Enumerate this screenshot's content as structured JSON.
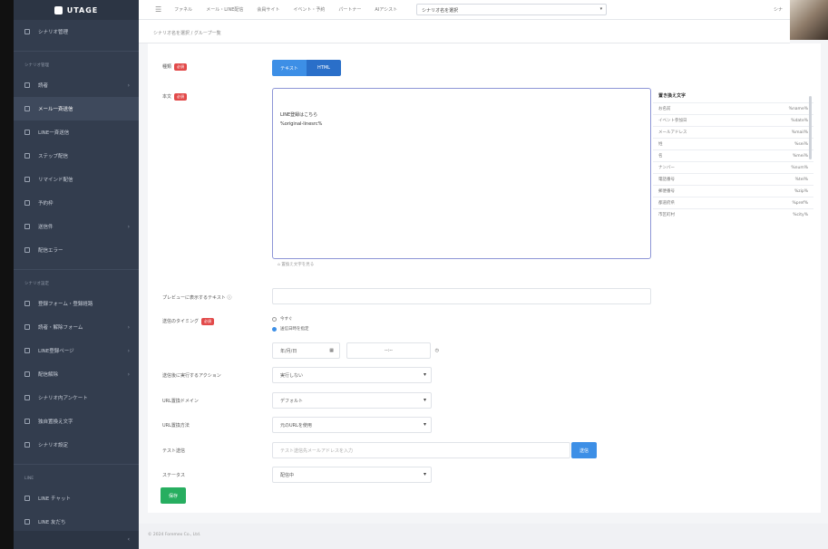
{
  "app": {
    "logo": "UTAGE"
  },
  "sidebar": {
    "top_item": "シナリオ管理",
    "section1": "シナリオ管理",
    "items1": [
      {
        "label": "読者",
        "arrow": "›"
      },
      {
        "label": "メール一斉送信",
        "arrow": ""
      },
      {
        "label": "LINE一斉送信",
        "arrow": ""
      },
      {
        "label": "ステップ配信",
        "arrow": ""
      },
      {
        "label": "リマインド配信",
        "arrow": ""
      },
      {
        "label": "予約枠",
        "arrow": ""
      },
      {
        "label": "送信件",
        "arrow": "›"
      },
      {
        "label": "配信エラー",
        "arrow": ""
      }
    ],
    "section2": "シナリオ設定",
    "items2": [
      {
        "label": "登録フォーム・登録経路",
        "arrow": ""
      },
      {
        "label": "読者・解除フォーム",
        "arrow": "›"
      },
      {
        "label": "LINE登録ページ",
        "arrow": "›"
      },
      {
        "label": "配信解除",
        "arrow": "›"
      },
      {
        "label": "シナリオ内アンケート",
        "arrow": ""
      },
      {
        "label": "独自置換え文字",
        "arrow": ""
      },
      {
        "label": "シナリオ設定",
        "arrow": ""
      }
    ],
    "section3": "LINE",
    "items3": [
      {
        "label": "LINE チャット",
        "arrow": ""
      },
      {
        "label": "LINE 友だち",
        "arrow": ""
      }
    ],
    "collapse": "‹"
  },
  "topbar": {
    "menu_icon": "☰",
    "nav": [
      "ファネル",
      "メール・LINE配信",
      "会員サイト",
      "イベント・予約",
      "パートナー",
      "AIアシスト"
    ],
    "selector": "シナリオ名を選択",
    "user": "シナ"
  },
  "breadcrumb": "シナリオ名を選択 / グループ一覧",
  "form": {
    "type_label": "種類",
    "required": "必須",
    "type_options": [
      "テキスト",
      "HTML"
    ],
    "body_label": "本文",
    "body_lines": [
      "LINE登録はこちら",
      "%original-linesrc%"
    ],
    "body_hint": "⌂ 置換え文字を見る",
    "tags_header": "置き換え文字",
    "tags": [
      {
        "name": "お名前",
        "code": "%name%"
      },
      {
        "name": "イベント参加日",
        "code": "%date%"
      },
      {
        "name": "メールアドレス",
        "code": "%mail%"
      },
      {
        "name": "姓",
        "code": "%sei%"
      },
      {
        "name": "名",
        "code": "%mei%"
      },
      {
        "name": "ナンバー",
        "code": "%num%"
      },
      {
        "name": "電話番号",
        "code": "%tel%"
      },
      {
        "name": "郵便番号",
        "code": "%zip%"
      },
      {
        "name": "都道府県",
        "code": "%pref%"
      },
      {
        "name": "市区町村",
        "code": "%city%"
      }
    ],
    "preview_label": "プレビューに表示するテキスト ⓘ",
    "timing_label": "送信のタイミング",
    "timing_options": [
      "今すぐ",
      "送信日時を指定"
    ],
    "date": "年/月/日",
    "time": "--:--",
    "action_label": "送信後に実行するアクション",
    "action_value": "実行しない",
    "url_domain_label": "URL置換ドメイン",
    "url_domain_value": "デフォルト",
    "url_method_label": "URL置換方法",
    "url_method_value": "元のURLを使用",
    "test_label": "テスト送信",
    "test_placeholder": "テスト送信先メールアドレスを入力",
    "test_button": "送信",
    "status_label": "ステータス",
    "status_value": "配信中",
    "save_button": "保存"
  },
  "footer": "© 2024 Foremex Co., Ltd."
}
